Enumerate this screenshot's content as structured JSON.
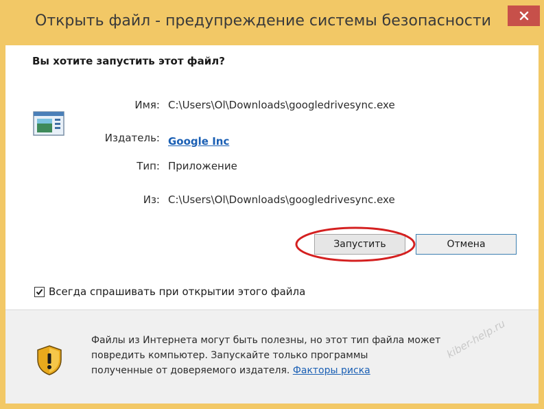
{
  "window": {
    "title": "Открыть файл - предупреждение системы безопасности",
    "close_icon": "close-icon",
    "accent_color": "#f2c866",
    "close_color": "#c7504a"
  },
  "dialog": {
    "question": "Вы хотите запустить этот файл?",
    "app_icon": "application-icon",
    "fields": {
      "name_label": "Имя:",
      "name_value": "C:\\Users\\Ol\\Downloads\\googledrivesync.exe",
      "publisher_label": "Издатель:",
      "publisher_value": "Google Inc",
      "type_label": "Тип:",
      "type_value": "Приложение",
      "from_label": "Из:",
      "from_value": "C:\\Users\\Ol\\Downloads\\googledrivesync.exe"
    },
    "buttons": {
      "run_label": "Запустить",
      "cancel_label": "Отмена"
    },
    "checkbox": {
      "label": "Всегда спрашивать при открытии этого файла",
      "checked": true
    },
    "annotation_color": "#d42020"
  },
  "footer": {
    "shield_icon": "warning-shield-icon",
    "line1": "Файлы из Интернета могут быть полезны, но этот тип файла может",
    "line2": "повредить компьютер. Запускайте только программы",
    "line3_text": "полученные от доверяемого издателя. ",
    "risk_link": "Факторы риска"
  },
  "watermark": "kiber-help.ru"
}
